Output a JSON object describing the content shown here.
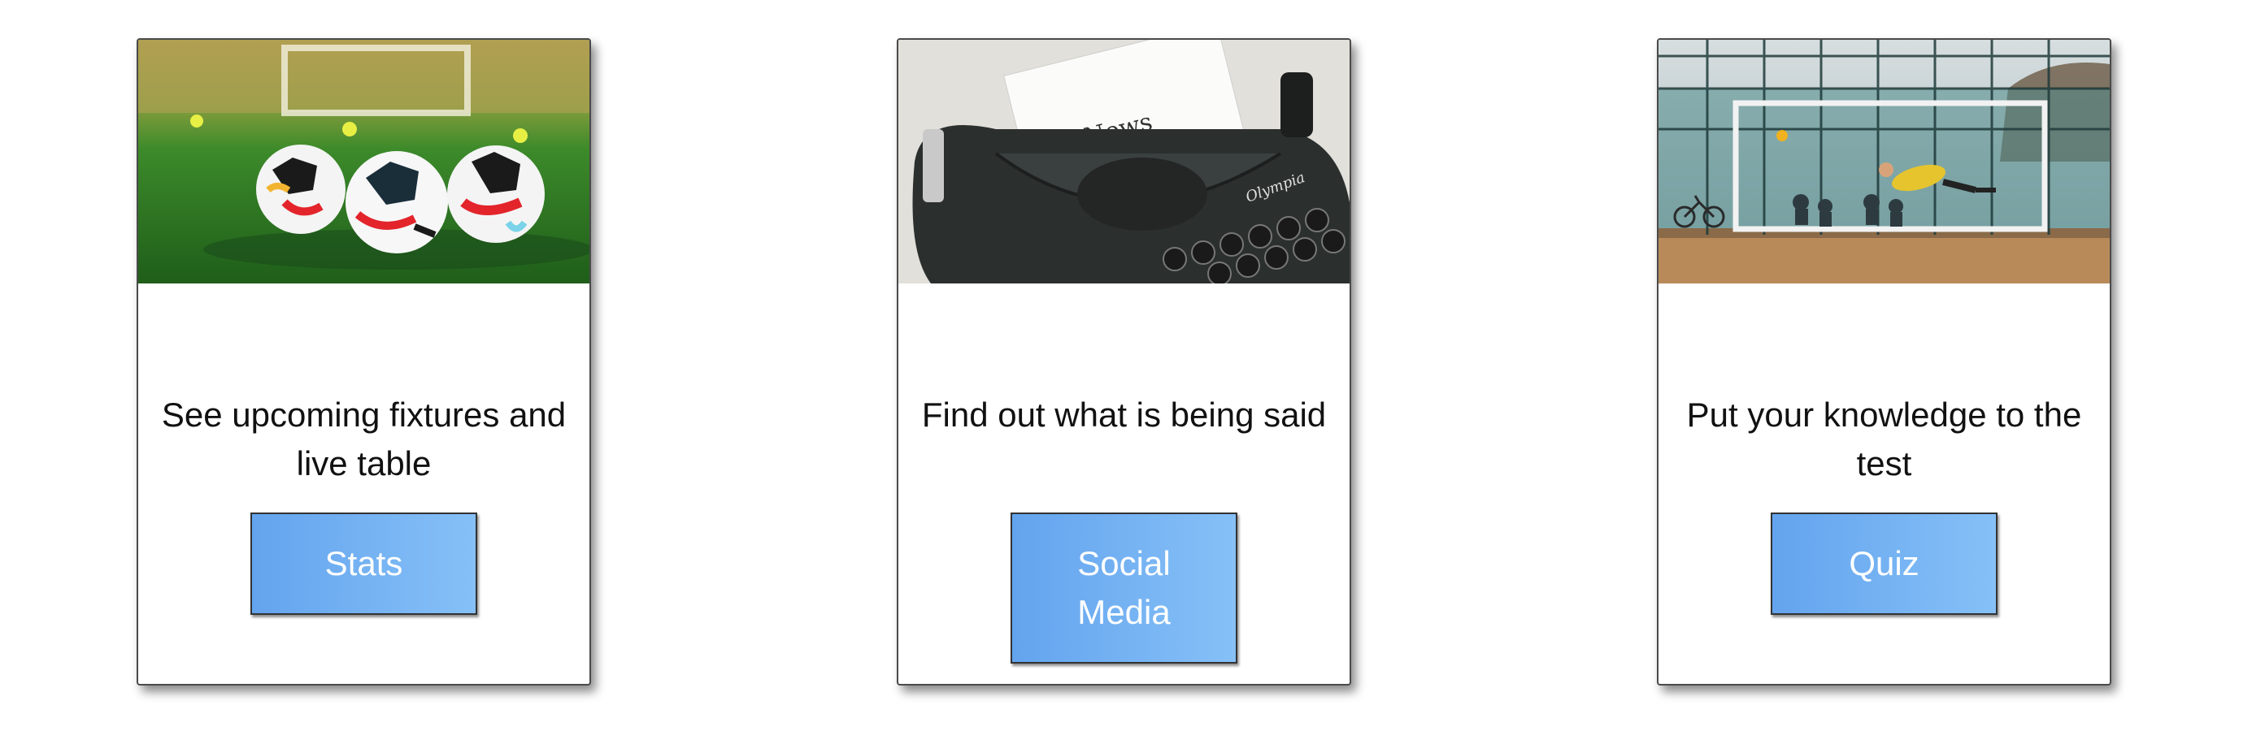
{
  "cards": [
    {
      "image_subject": "soccer-balls-on-grass",
      "text": "See upcoming fixtures and live table",
      "button_label": "Stats"
    },
    {
      "image_subject": "typewriter-news",
      "text": "Find out what is being said",
      "button_label": "Social Media",
      "image_caption": "News",
      "image_brand": "Olympia"
    },
    {
      "image_subject": "goalkeeper-diving-cage-pitch",
      "text": "Put your knowledge to the test",
      "button_label": "Quiz"
    }
  ],
  "colors": {
    "button_gradient_start": "#63a4ee",
    "button_gradient_end": "#86c0f7",
    "button_text": "#ffffff",
    "card_border": "#4a4a4a",
    "body_text": "#111111"
  }
}
